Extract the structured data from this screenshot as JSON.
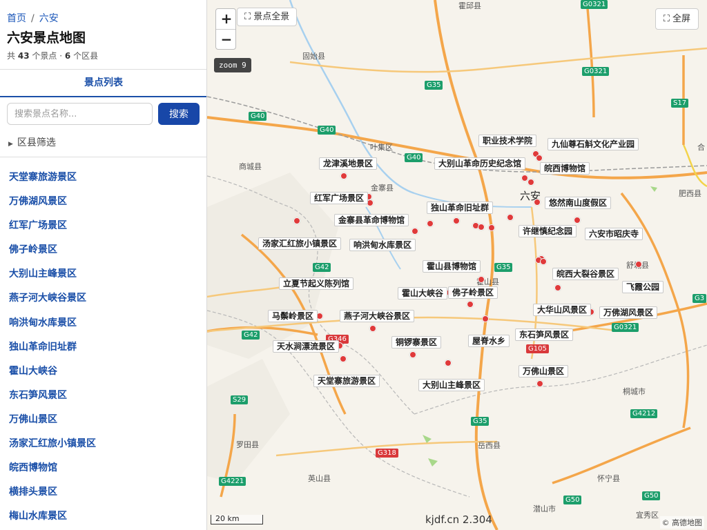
{
  "breadcrumb": {
    "home": "首页",
    "sep": "/",
    "current": "六安"
  },
  "page_title": "六安景点地图",
  "stats": {
    "prefix": "共",
    "spots": "43",
    "spots_unit": "个景点",
    "dot": "·",
    "counties": "6",
    "counties_unit": "个区县"
  },
  "tab_label": "景点列表",
  "search": {
    "placeholder": "搜索景点名称...",
    "button": "搜索"
  },
  "filter_label": "区县筛选",
  "spot_list": [
    "天堂寨旅游景区",
    "万佛湖风景区",
    "红军广场景区",
    "佛子岭景区",
    "大别山主峰景区",
    "燕子河大峡谷景区",
    "响洪甸水库景区",
    "独山革命旧址群",
    "霍山大峡谷",
    "东石笋风景区",
    "万佛山景区",
    "汤家汇红旅小镇景区",
    "皖西博物馆",
    "横排头景区",
    "梅山水库景区"
  ],
  "map": {
    "zoom_in": "+",
    "zoom_out": "−",
    "show_all": "景点全景",
    "fullscreen": "全屏",
    "zoom_badge": "zoom 9",
    "scale": "20 km",
    "watermark": "kjdf.cn 2.304",
    "attribution": "© 高德地图",
    "city_label": "六安",
    "places": [
      "固始县",
      "叶集区",
      "商城县",
      "金寨县",
      "霍山县",
      "舒城县",
      "岳西县",
      "罗田县",
      "英山县",
      "怀宁县",
      "潜山市",
      "宜秀区",
      "桐城市",
      "肥西县",
      "合",
      "霍邱县"
    ],
    "shields": [
      "G0321",
      "G0321",
      "G35",
      "G40",
      "G40",
      "G40",
      "S17",
      "G42",
      "G42",
      "G35",
      "G346",
      "G105",
      "G3",
      "G0321",
      "S29",
      "G35",
      "G318",
      "G4221",
      "G50",
      "G50",
      "G4212"
    ],
    "labels": [
      "龙津溪地景区",
      "职业技术学院",
      "九仙尊石斛文化产业园",
      "大别山革命历史纪念馆",
      "皖西博物馆",
      "红军广场景区",
      "悠然南山度假区",
      "独山革命旧址群",
      "金寨县革命博物馆",
      "许继慎纪念园",
      "六安市昭庆寺",
      "汤家汇红旅小镇景区",
      "响洪甸水库景区",
      "霍山县博物馆",
      "皖西大裂谷景区",
      "立夏节起义陈列馆",
      "飞霞公园",
      "霍山大峡谷",
      "佛子岭景区",
      "大华山风景区",
      "万佛湖风景区",
      "马鬃岭景区",
      "燕子河大峡谷景区",
      "东石笋风景区",
      "天水涧漂流景区",
      "铜锣寨景区",
      "屋脊水乡",
      "万佛山景区",
      "天堂寨旅游景区",
      "大别山主峰景区"
    ],
    "colors": {
      "expressway": "#f4a64a",
      "road": "#f6c87a",
      "water": "#a7d0ef",
      "border": "#aaaaaa",
      "marker": "#e03a3a",
      "shield_green": "#1c9e6b",
      "shield_red": "#d9393b"
    }
  }
}
